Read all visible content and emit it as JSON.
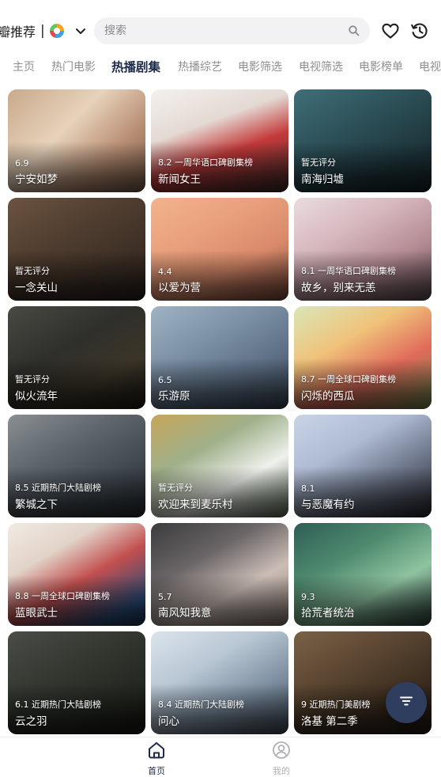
{
  "header": {
    "brand_text": "瓣推荐",
    "separator": "|",
    "search_placeholder": "搜索"
  },
  "tabs": [
    {
      "label": "主页"
    },
    {
      "label": "热门电影"
    },
    {
      "label": "热播剧集",
      "active": true
    },
    {
      "label": "热播综艺"
    },
    {
      "label": "电影筛选"
    },
    {
      "label": "电视筛选"
    },
    {
      "label": "电影榜单"
    },
    {
      "label": "电视榜"
    }
  ],
  "cards": [
    {
      "meta": "6.9",
      "title": "宁安如梦"
    },
    {
      "meta": "8.2 一周华语口碑剧集榜",
      "title": "新闻女王"
    },
    {
      "meta": "暂无评分",
      "title": "南海归墟"
    },
    {
      "meta": "暂无评分",
      "title": "一念关山"
    },
    {
      "meta": "4.4",
      "title": "以爱为营"
    },
    {
      "meta": "8.1 一周华语口碑剧集榜",
      "title": "故乡，别来无恙"
    },
    {
      "meta": "暂无评分",
      "title": "似火流年"
    },
    {
      "meta": "6.5",
      "title": "乐游原"
    },
    {
      "meta": "8.7 一周全球口碑剧集榜",
      "title": "闪烁的西瓜"
    },
    {
      "meta": "8.5 近期热门大陆剧榜",
      "title": "繁城之下"
    },
    {
      "meta": "暂无评分",
      "title": "欢迎来到麦乐村"
    },
    {
      "meta": "8.1",
      "title": "与恶魔有约"
    },
    {
      "meta": "8.8 一周全球口碑剧集榜",
      "title": "蓝眼武士"
    },
    {
      "meta": "5.7",
      "title": "南风知我意"
    },
    {
      "meta": "9.3",
      "title": "拾荒者统治"
    },
    {
      "meta": "6.1 近期热门大陆剧榜",
      "title": "云之羽"
    },
    {
      "meta": "8.4 近期热门大陆剧榜",
      "title": "问心"
    },
    {
      "meta": "9 近期热门美剧榜",
      "title": "洛基 第二季"
    }
  ],
  "bottom_nav": [
    {
      "label": "首页",
      "icon": "home-icon",
      "active": true
    },
    {
      "label": "我的",
      "icon": "profile-icon"
    }
  ],
  "colors": {
    "accent": "#1d2a4a",
    "fab": "#2f3d5e",
    "inactive_tab": "#8e8e93",
    "search_bg": "#f2f2f4"
  }
}
